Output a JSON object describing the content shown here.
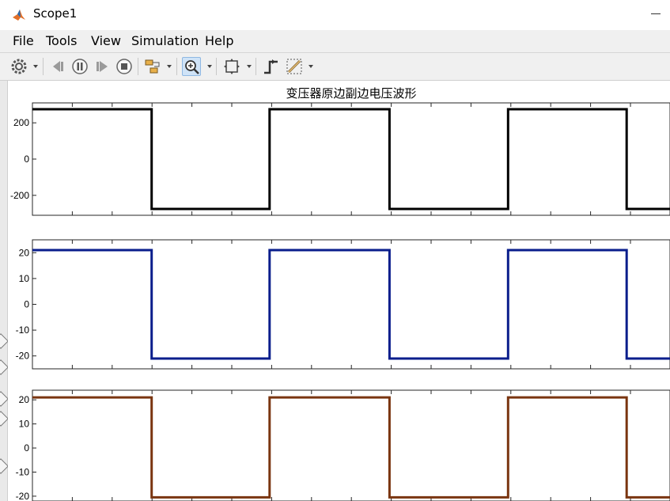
{
  "window": {
    "title": "Scope1"
  },
  "menu": [
    "File",
    "Tools",
    "View",
    "Simulation",
    "Help"
  ],
  "toolbar": {
    "icons": [
      "gear-icon",
      "step-back-icon",
      "pause-icon",
      "step-forward-icon",
      "stop-icon",
      "highlight-block-icon",
      "zoom-icon",
      "fit-to-view-icon",
      "triggers-icon",
      "cursor-measurements-icon"
    ]
  },
  "chart_data": [
    {
      "type": "line",
      "title": "变压器原边副边电压波形",
      "yticks": [
        200,
        0,
        -200
      ],
      "ylim": [
        -310,
        310
      ],
      "xlim": [
        0,
        1
      ],
      "color": "#000000",
      "x": [
        0,
        0.187,
        0.187,
        0.372,
        0.372,
        0.56,
        0.56,
        0.746,
        0.746,
        0.932,
        0.932,
        1
      ],
      "y": [
        275,
        275,
        -275,
        -275,
        275,
        275,
        -275,
        -275,
        275,
        275,
        -275,
        -275
      ]
    },
    {
      "type": "line",
      "title": "",
      "yticks": [
        20,
        10,
        0,
        -10,
        -20
      ],
      "ylim": [
        -25,
        25
      ],
      "xlim": [
        0,
        1
      ],
      "color": "#0a1e8c",
      "x": [
        0,
        0.187,
        0.187,
        0.372,
        0.372,
        0.56,
        0.56,
        0.746,
        0.746,
        0.932,
        0.932,
        1
      ],
      "y": [
        21,
        21,
        -21,
        -21,
        21,
        21,
        -21,
        -21,
        21,
        21,
        -21,
        -21
      ]
    },
    {
      "type": "line",
      "title": "",
      "yticks": [
        20,
        10,
        0,
        -10,
        -20
      ],
      "ylim": [
        -22,
        24
      ],
      "xlim": [
        0,
        1
      ],
      "color": "#7a3510",
      "x": [
        0,
        0.187,
        0.187,
        0.372,
        0.372,
        0.56,
        0.56,
        0.746,
        0.746,
        0.932,
        0.932,
        1
      ],
      "y": [
        21,
        21,
        -20.5,
        -20.5,
        21,
        21,
        -20.5,
        -20.5,
        21,
        21,
        -20.5,
        -20.5
      ]
    }
  ]
}
